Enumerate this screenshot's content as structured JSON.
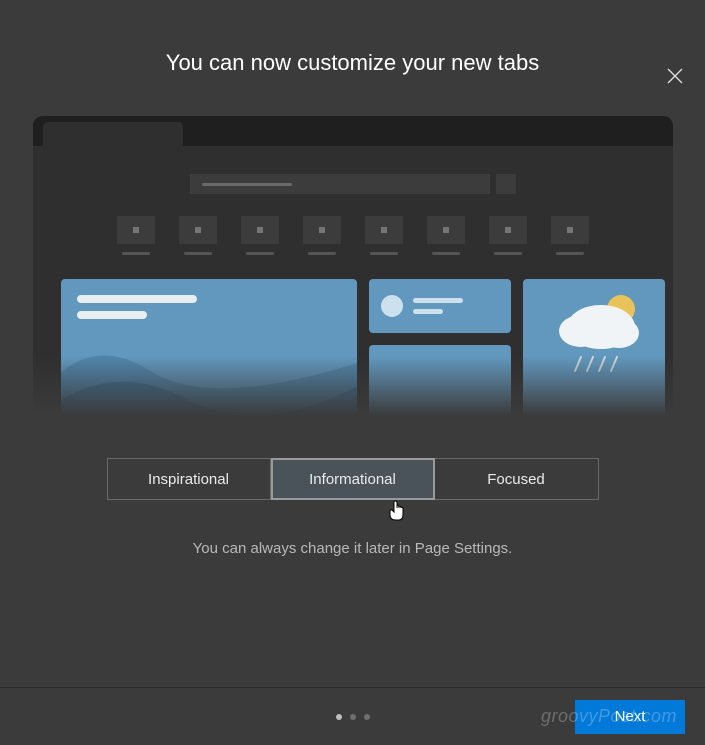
{
  "title": "You can now customize your new tabs",
  "options": {
    "inspirational": "Inspirational",
    "informational": "Informational",
    "focused": "Focused",
    "selected_index": 1
  },
  "hint": "You can always change it later in Page Settings.",
  "next_label": "Next",
  "watermark": "groovyPost.com",
  "pagination": {
    "total": 3,
    "current": 0
  }
}
